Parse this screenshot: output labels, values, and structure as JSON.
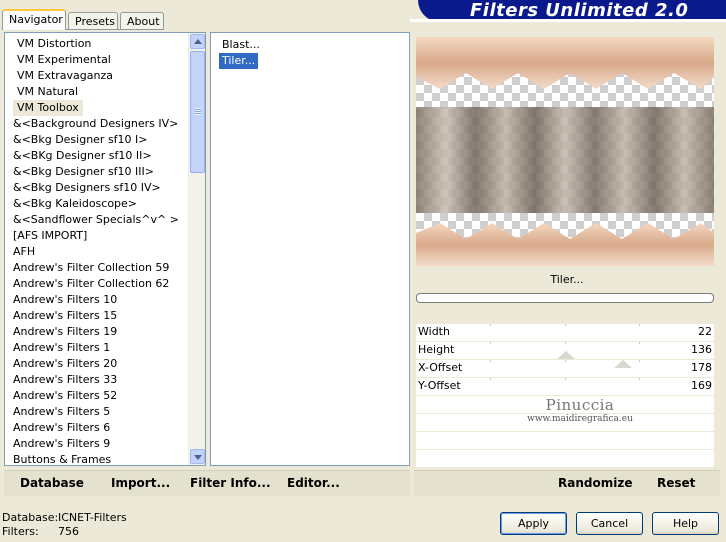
{
  "tabs": [
    "Navigator",
    "Presets",
    "About"
  ],
  "app_title": "Filters Unlimited 2.0",
  "categories": [
    "VM Distortion",
    "VM Experimental",
    "VM Extravaganza",
    "VM Natural",
    "VM Toolbox",
    "&<Background Designers IV>",
    "&<Bkg Designer sf10 I>",
    "&<BKg Designer sf10 II>",
    "&<Bkg Designer sf10 III>",
    "&<Bkg Designers sf10 IV>",
    "&<Bkg Kaleidoscope>",
    "&<Sandflower Specials^v^ >",
    "[AFS IMPORT]",
    "AFH",
    "Andrew's Filter Collection 59",
    "Andrew's Filter Collection 62",
    "Andrew's Filters 10",
    "Andrew's Filters 15",
    "Andrew's Filters 19",
    "Andrew's Filters 1",
    "Andrew's Filters 20",
    "Andrew's Filters 33",
    "Andrew's Filters 52",
    "Andrew's Filters 5",
    "Andrew's Filters 6",
    "Andrew's Filters 9",
    "Buttons & Frames"
  ],
  "selected_category": "VM Toolbox",
  "filters": [
    "Blast...",
    "Tiler..."
  ],
  "selected_filter": "Tiler...",
  "preview_filter_name": "Tiler...",
  "params": [
    {
      "label": "Width",
      "value": "22"
    },
    {
      "label": "Height",
      "value": "136"
    },
    {
      "label": "X-Offset",
      "value": "178"
    },
    {
      "label": "Y-Offset",
      "value": "169"
    }
  ],
  "watermark": {
    "name": "Pinuccia",
    "url": "www.maidiregrafica.eu"
  },
  "left_toolbar": [
    "Database",
    "Import...",
    "Filter Info...",
    "Editor..."
  ],
  "right_toolbar": [
    "Randomize",
    "Reset"
  ],
  "status": {
    "database_label": "Database:",
    "database_value": "ICNET-Filters",
    "filters_label": "Filters:",
    "filters_value": "756"
  },
  "buttons": {
    "apply": "Apply",
    "cancel": "Cancel",
    "help": "Help"
  },
  "colors": {
    "selection": "#316ac5",
    "banner": "#0a1a8c",
    "tab_highlight": "#ffc83c"
  }
}
